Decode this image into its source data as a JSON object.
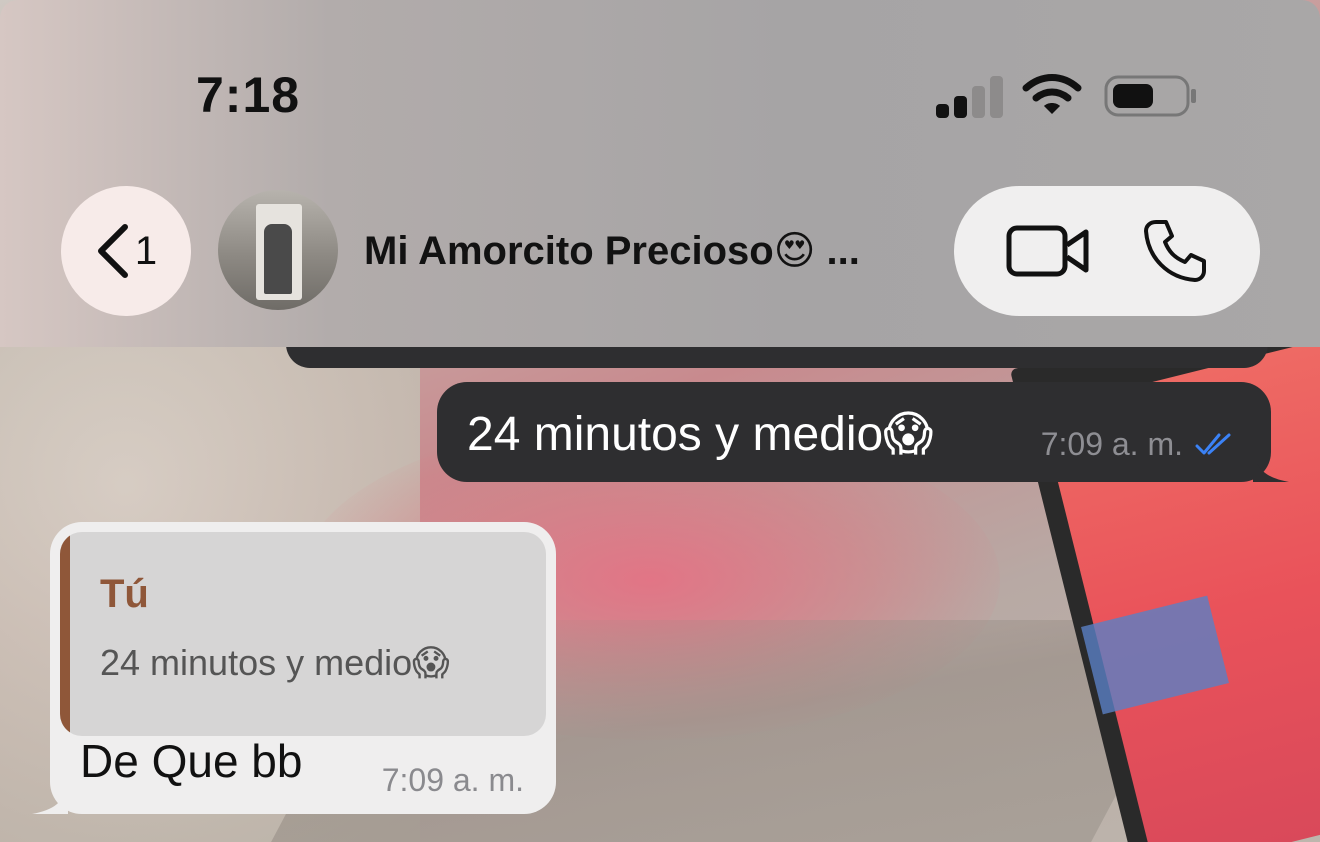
{
  "status_bar": {
    "time": "7:18"
  },
  "header": {
    "back_count": "1",
    "contact_name": "Mi Amorcito Precioso😍 ...",
    "icons": {
      "back": "chevron-left-icon",
      "video": "video-camera-icon",
      "call": "phone-icon"
    }
  },
  "messages": [
    {
      "direction": "outgoing",
      "text": "24 minutos y medio😱",
      "time": "7:09 a. m.",
      "status_icon": "double-check-read-icon",
      "status_color": "#3b82f6"
    },
    {
      "direction": "incoming",
      "reply_to": {
        "author": "Tú",
        "text": "24 minutos y medio😱"
      },
      "text": "De Que bb",
      "time": "7:09 a. m."
    }
  ],
  "colors": {
    "outgoing_bubble": "#2e2e30",
    "incoming_bubble": "#efeeee",
    "quote_accent": "#8f5739"
  }
}
